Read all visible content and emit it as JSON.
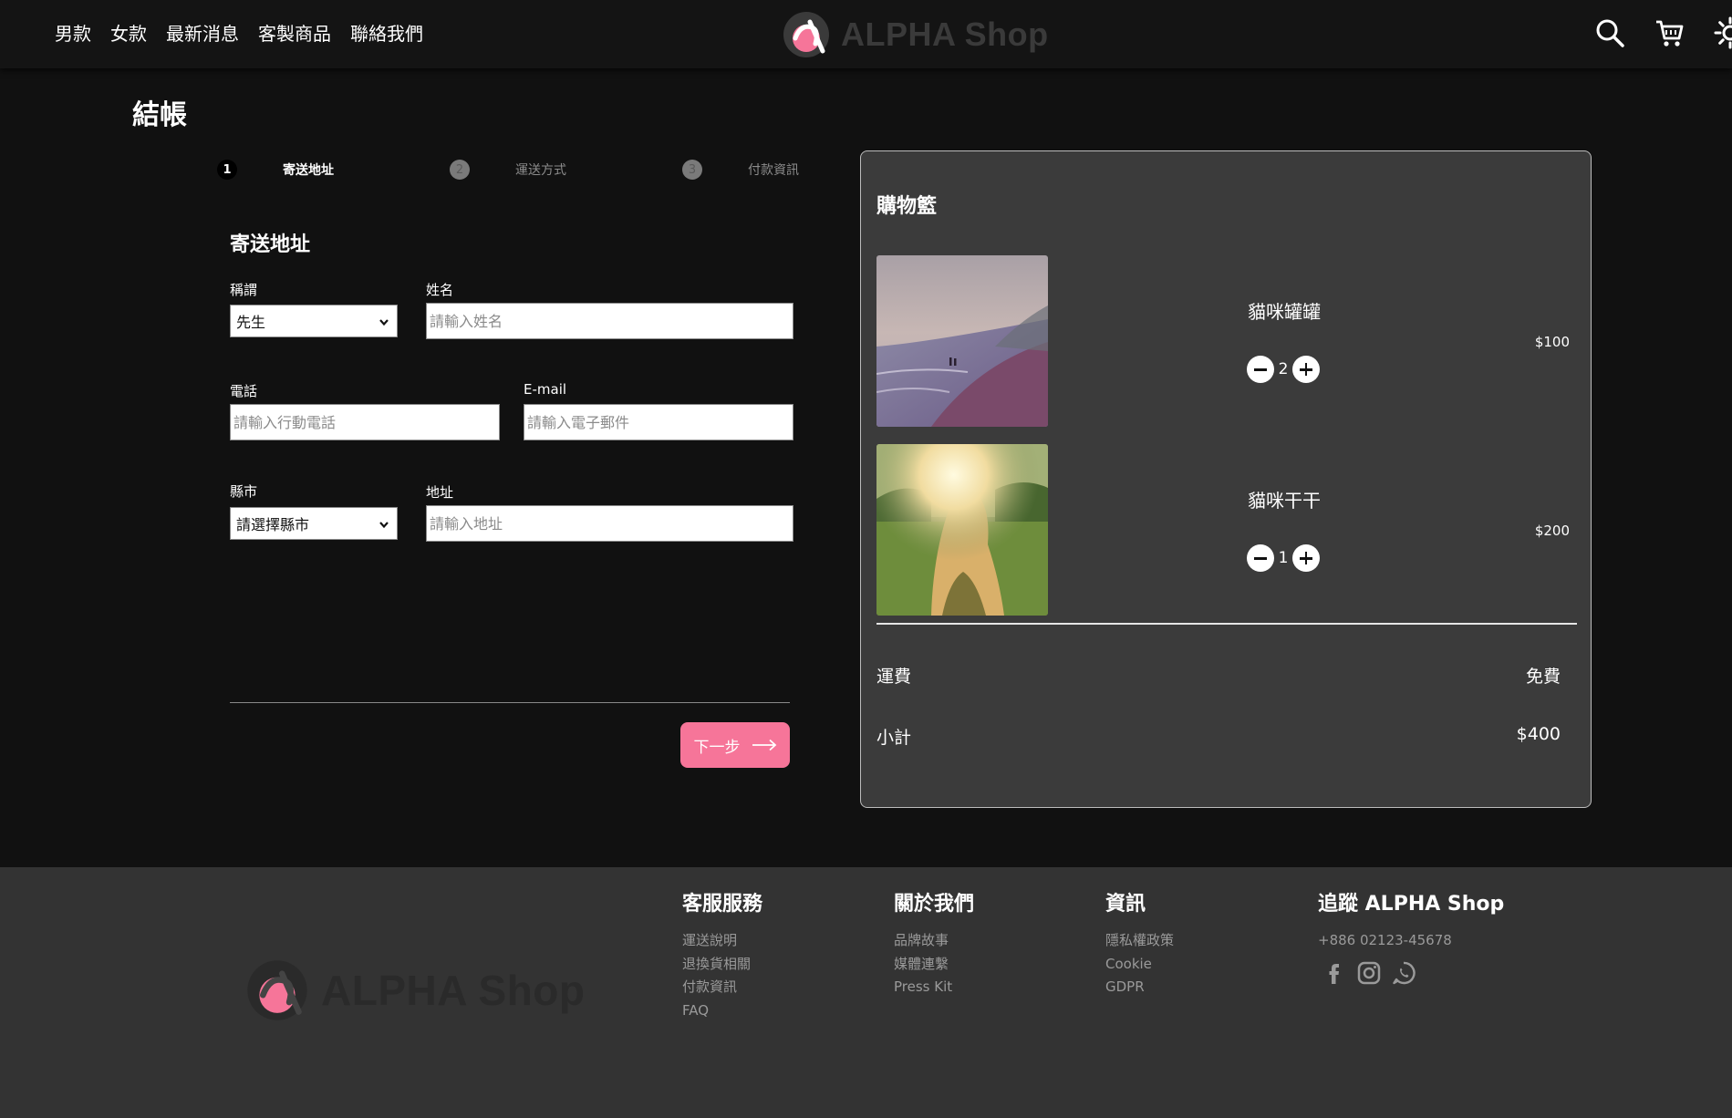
{
  "header": {
    "nav": [
      "男款",
      "女款",
      "最新消息",
      "客製商品",
      "聯絡我們"
    ],
    "brand": "ALPHA Shop",
    "icons": [
      "search-icon",
      "cart-icon",
      "theme-sun-icon"
    ]
  },
  "page_title": "結帳",
  "stepper": [
    {
      "num": "1",
      "label": "寄送地址",
      "state": "active"
    },
    {
      "num": "2",
      "label": "運送方式",
      "state": "inactive"
    },
    {
      "num": "3",
      "label": "付款資訊",
      "state": "inactive"
    }
  ],
  "form": {
    "title": "寄送地址",
    "salutation": {
      "label": "稱謂",
      "value": "先生"
    },
    "name": {
      "label": "姓名",
      "placeholder": "請輸入姓名"
    },
    "phone": {
      "label": "電話",
      "placeholder": "請輸入行動電話"
    },
    "email": {
      "label": "E-mail",
      "placeholder": "請輸入電子郵件"
    },
    "city": {
      "label": "縣市",
      "value": "請選擇縣市"
    },
    "address": {
      "label": "地址",
      "placeholder": "請輸入地址"
    },
    "next_label": "下一步"
  },
  "cart": {
    "title": "購物籃",
    "items": [
      {
        "name": "貓咪罐罐",
        "quantity": "2",
        "price": "$100"
      },
      {
        "name": "貓咪干干",
        "quantity": "1",
        "price": "$200"
      }
    ],
    "shipping_label": "運費",
    "shipping_value": "免費",
    "subtotal_label": "小計",
    "subtotal_value": "$400"
  },
  "footer": {
    "brand": "ALPHA Shop",
    "columns": [
      {
        "title": "客服服務",
        "links": [
          "運送說明",
          "退換貨相關",
          "付款資訊",
          "FAQ"
        ]
      },
      {
        "title": "關於我們",
        "links": [
          "品牌故事",
          "媒體連繫",
          "Press Kit"
        ]
      },
      {
        "title": "資訊",
        "links": [
          "隱私權政策",
          "Cookie",
          "GDPR"
        ]
      },
      {
        "title": "追蹤 ALPHA Shop",
        "phone": "+886 02123-45678",
        "social": [
          "facebook-icon",
          "instagram-icon",
          "whatsapp-icon"
        ]
      }
    ]
  },
  "colors": {
    "accent": "#f67599",
    "background": "#111111",
    "panel": "#3b3b3b",
    "footer": "#333333"
  }
}
